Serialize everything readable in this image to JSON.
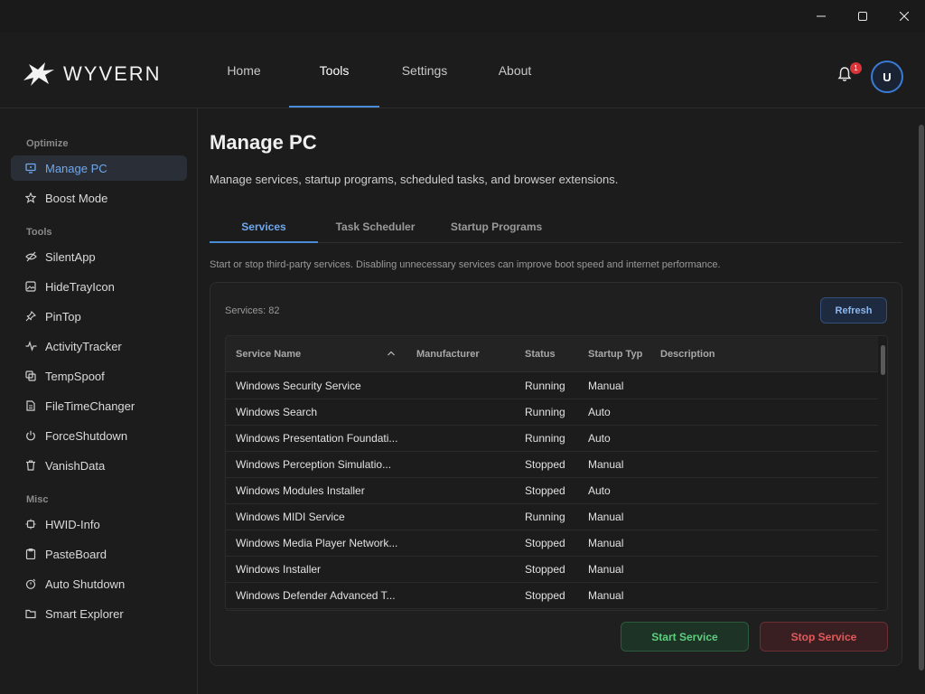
{
  "app": {
    "logo_text": "WYVERN"
  },
  "titlebar": {
    "minimize": "minimize",
    "maximize": "maximize",
    "close": "close"
  },
  "nav": {
    "tabs": [
      {
        "label": "Home"
      },
      {
        "label": "Tools"
      },
      {
        "label": "Settings"
      },
      {
        "label": "About"
      }
    ],
    "active": "Tools",
    "notifications": "1",
    "avatar": "U"
  },
  "sidebar": {
    "sections": [
      {
        "title": "Optimize"
      },
      {
        "title": "Tools"
      },
      {
        "title": "Misc"
      }
    ],
    "items": [
      {
        "label": "Manage PC",
        "icon": "monitor-icon"
      },
      {
        "label": "Boost Mode",
        "icon": "star-icon"
      },
      {
        "label": "SilentApp",
        "icon": "eye-off-icon"
      },
      {
        "label": "HideTrayIcon",
        "icon": "image-icon"
      },
      {
        "label": "PinTop",
        "icon": "pin-icon"
      },
      {
        "label": "ActivityTracker",
        "icon": "activity-icon"
      },
      {
        "label": "TempSpoof",
        "icon": "copy-icon"
      },
      {
        "label": "FileTimeChanger",
        "icon": "file-icon"
      },
      {
        "label": "ForceShutdown",
        "icon": "power-icon"
      },
      {
        "label": "VanishData",
        "icon": "trash-icon"
      },
      {
        "label": "HWID-Info",
        "icon": "chip-icon"
      },
      {
        "label": "PasteBoard",
        "icon": "clipboard-icon"
      },
      {
        "label": "Auto Shutdown",
        "icon": "timer-icon"
      },
      {
        "label": "Smart Explorer",
        "icon": "folder-icon"
      }
    ]
  },
  "main": {
    "title": "Manage PC",
    "subtitle": "Manage services, startup programs, scheduled tasks, and browser extensions.",
    "tabs": [
      {
        "label": "Services"
      },
      {
        "label": "Task Scheduler"
      },
      {
        "label": "Startup Programs"
      }
    ],
    "note": "Start or stop third-party services. Disabling unnecessary services can improve boot speed and internet performance.",
    "services_count": "Services: 82",
    "refresh_label": "Refresh",
    "columns": [
      "Service Name",
      "Manufacturer",
      "Status",
      "Startup Typ",
      "Description"
    ],
    "rows": [
      {
        "name": "Windows Security Service",
        "manufacturer": "",
        "status": "Running",
        "startup": "Manual",
        "description": ""
      },
      {
        "name": "Windows Search",
        "manufacturer": "",
        "status": "Running",
        "startup": "Auto",
        "description": ""
      },
      {
        "name": "Windows Presentation Foundati...",
        "manufacturer": "",
        "status": "Running",
        "startup": "Auto",
        "description": ""
      },
      {
        "name": "Windows Perception Simulatio...",
        "manufacturer": "",
        "status": "Stopped",
        "startup": "Manual",
        "description": ""
      },
      {
        "name": "Windows Modules Installer",
        "manufacturer": "",
        "status": "Stopped",
        "startup": "Auto",
        "description": ""
      },
      {
        "name": "Windows MIDI Service",
        "manufacturer": "",
        "status": "Running",
        "startup": "Manual",
        "description": ""
      },
      {
        "name": "Windows Media Player Network...",
        "manufacturer": "",
        "status": "Stopped",
        "startup": "Manual",
        "description": ""
      },
      {
        "name": "Windows Installer",
        "manufacturer": "",
        "status": "Stopped",
        "startup": "Manual",
        "description": ""
      },
      {
        "name": "Windows Defender Advanced T...",
        "manufacturer": "",
        "status": "Stopped",
        "startup": "Manual",
        "description": ""
      }
    ],
    "start_label": "Start Service",
    "stop_label": "Stop Service"
  },
  "colors": {
    "accent": "#4a8bd8",
    "start": "#5ccf7e",
    "stop": "#e25a5a",
    "badge": "#d8343a"
  }
}
